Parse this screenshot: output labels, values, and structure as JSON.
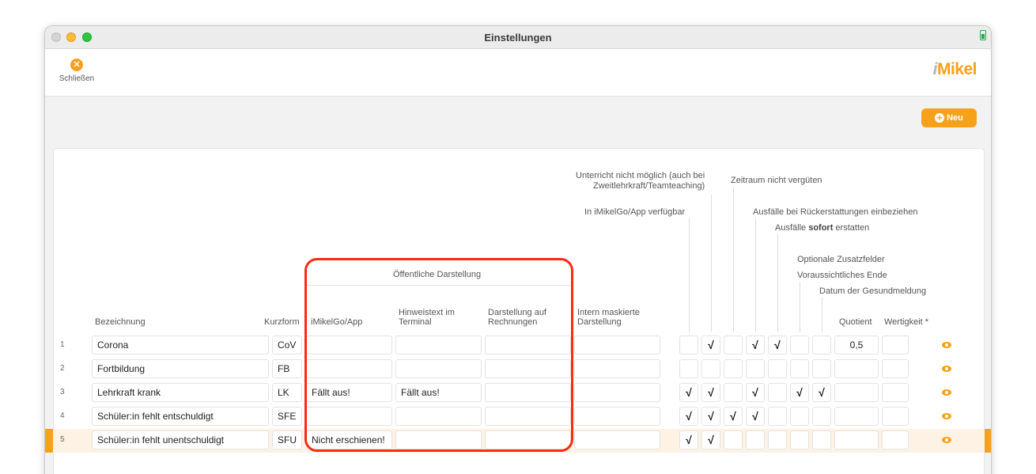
{
  "window": {
    "title": "Einstellungen"
  },
  "toolbar": {
    "close_label": "Schließen",
    "logo_prefix": "i",
    "logo_text": "Mikel"
  },
  "actions": {
    "new_label": "Neu"
  },
  "headers": {
    "unterricht": "Unterricht nicht möglich (auch bei",
    "unterricht2": "Zweitlehrkraft/Teamteaching)",
    "zeitraum": "Zeitraum nicht vergüten",
    "app_verfuegbar": "In iMikelGo/App verfügbar",
    "rueckerstattungen": "Ausfälle bei Rückerstattungen einbeziehen",
    "sofort_pre": "Ausfälle ",
    "sofort_bold": "sofort",
    "sofort_post": " erstatten",
    "zusatzfelder": "Optionale Zusatzfelder",
    "ende": "Voraussichtliches Ende",
    "gesundmeldung": "Datum der Gesundmeldung",
    "oeffentliche": "Öffentliche Darstellung",
    "bezeichnung": "Bezeichnung",
    "kurzform": "Kurzform",
    "imikelgo": "iMikelGo/App",
    "hinweis1": "Hinweistext im",
    "hinweis2": "Terminal",
    "rechnung1": "Darstellung auf",
    "rechnung2": "Rechnungen",
    "intern1": "Intern maskierte",
    "intern2": "Darstellung",
    "quotient": "Quotient",
    "wertigkeit": "Wertigkeit *"
  },
  "rows": [
    {
      "num": "1",
      "bezeichnung": "Corona",
      "kurz": "CoV",
      "app": "",
      "hinweis": "",
      "rechnung": "",
      "intern": "",
      "c1": "",
      "c2": "√",
      "c3": "",
      "c4": "√",
      "c5": "√",
      "c6": "",
      "c7": "",
      "quotient": "0,5",
      "wert": ""
    },
    {
      "num": "2",
      "bezeichnung": "Fortbildung",
      "kurz": "FB",
      "app": "",
      "hinweis": "",
      "rechnung": "",
      "intern": "",
      "c1": "",
      "c2": "",
      "c3": "",
      "c4": "",
      "c5": "",
      "c6": "",
      "c7": "",
      "quotient": "",
      "wert": ""
    },
    {
      "num": "3",
      "bezeichnung": "Lehrkraft krank",
      "kurz": "LK",
      "app": "Fällt aus!",
      "hinweis": "Fällt aus!",
      "rechnung": "",
      "intern": "",
      "c1": "√",
      "c2": "√",
      "c3": "",
      "c4": "√",
      "c5": "",
      "c6": "√",
      "c7": "√",
      "quotient": "",
      "wert": ""
    },
    {
      "num": "4",
      "bezeichnung": "Schüler:in fehlt entschuldigt",
      "kurz": "SFE",
      "app": "",
      "hinweis": "",
      "rechnung": "",
      "intern": "",
      "c1": "√",
      "c2": "√",
      "c3": "√",
      "c4": "√",
      "c5": "",
      "c6": "",
      "c7": "",
      "quotient": "",
      "wert": ""
    },
    {
      "num": "5",
      "bezeichnung": "Schüler:in fehlt unentschuldigt",
      "kurz": "SFU",
      "app": "Nicht erschienen!",
      "hinweis": "",
      "rechnung": "",
      "intern": "",
      "c1": "√",
      "c2": "√",
      "c3": "",
      "c4": "",
      "c5": "",
      "c6": "",
      "c7": "",
      "quotient": "",
      "wert": ""
    }
  ],
  "colors": {
    "accent": "#f7a11b",
    "highlight_box": "#ff2a0f",
    "selected_row": "#fdf2e3"
  }
}
